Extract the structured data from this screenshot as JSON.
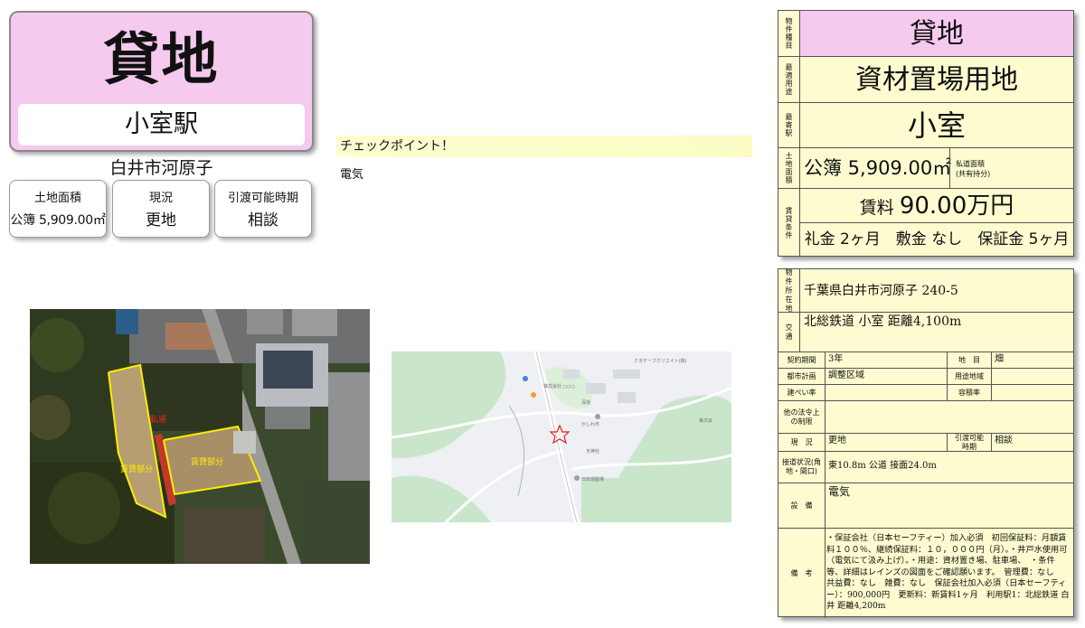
{
  "title": {
    "type": "貸地",
    "station": "小室駅",
    "address": "白井市河原子"
  },
  "info_boxes": [
    {
      "label": "土地面積",
      "value": "公簿 5,909.00㎡"
    },
    {
      "label": "現況",
      "value": "更地"
    },
    {
      "label": "引渡可能時期",
      "value": "相談"
    }
  ],
  "checkpoint": {
    "heading": "チェックポイント！",
    "text": "電気"
  },
  "aerial": {
    "labels": {
      "road": "私道",
      "parcel_left": "賃貸部分",
      "parcel_right": "賃貸部分"
    }
  },
  "map": {
    "labels": [
      "ミタケーブクリエイト(株)",
      "株式会社 ○○○",
      "深道",
      "かしわ市",
      "天神社",
      "日田運動場",
      "株式会"
    ]
  },
  "panel_top": {
    "type_label": "物件種目",
    "type_value": "貸地",
    "use_label": "最適用途",
    "use_value": "資材置場用地",
    "station_label": "最寄駅",
    "station_value": "小室",
    "area_label": "土地面積",
    "area_value": "公簿 5,909.00㎡",
    "private_road_label": "私道面積",
    "private_road_sub": "(共有持分)",
    "terms_label": "賃貸条件",
    "rent_prefix": "賃料",
    "rent_value": "90.00万円",
    "fees": "礼金 2ヶ月　敷金 なし　保証金 5ヶ月"
  },
  "panel_bot": {
    "location_label": "物件所在地",
    "location_value": "千葉県白井市河原子 240-5",
    "transport_label": "交通",
    "transport_value": "北総鉄道 小室 距離4,100m",
    "contract_label": "契約期間",
    "contract_value": "3年",
    "chimoku_label": "地　目",
    "chimoku_value": "畑",
    "city_plan_label": "都市計画",
    "city_plan_value": "調整区域",
    "zoning_label": "用途地域",
    "zoning_value": "",
    "bcr_label": "建ぺい率",
    "bcr_value": "",
    "far_label": "容積率",
    "far_value": "",
    "law_label": "他の法令上の制限",
    "law_value": "",
    "status_label": "現　況",
    "status_value": "更地",
    "handover_label": "引渡可能時期",
    "handover_value": "相談",
    "road_label": "接道状況(角地・間口)",
    "road_value": "東10.8m 公道 接面24.0m",
    "facility_label": "設　備",
    "facility_value": "電気",
    "notes_label": "備　考",
    "notes_value": "・保証会社（日本セーフティー）加入必須　初回保証料：月額賃料１００％、継続保証料：１０，０００円（月）。・井戸水使用可（電気にて汲み上げ）。・用途：資材置き場、駐車場、　・条件等、詳細はレインズの図面をご確認願います。　管理費：なし　共益費：なし　雑費：なし　保証会社加入必須（日本セーフティー）：900,000円　更新料：新賃料1ヶ月　利用駅1：北総鉄道 白井 距離4,200m"
  }
}
